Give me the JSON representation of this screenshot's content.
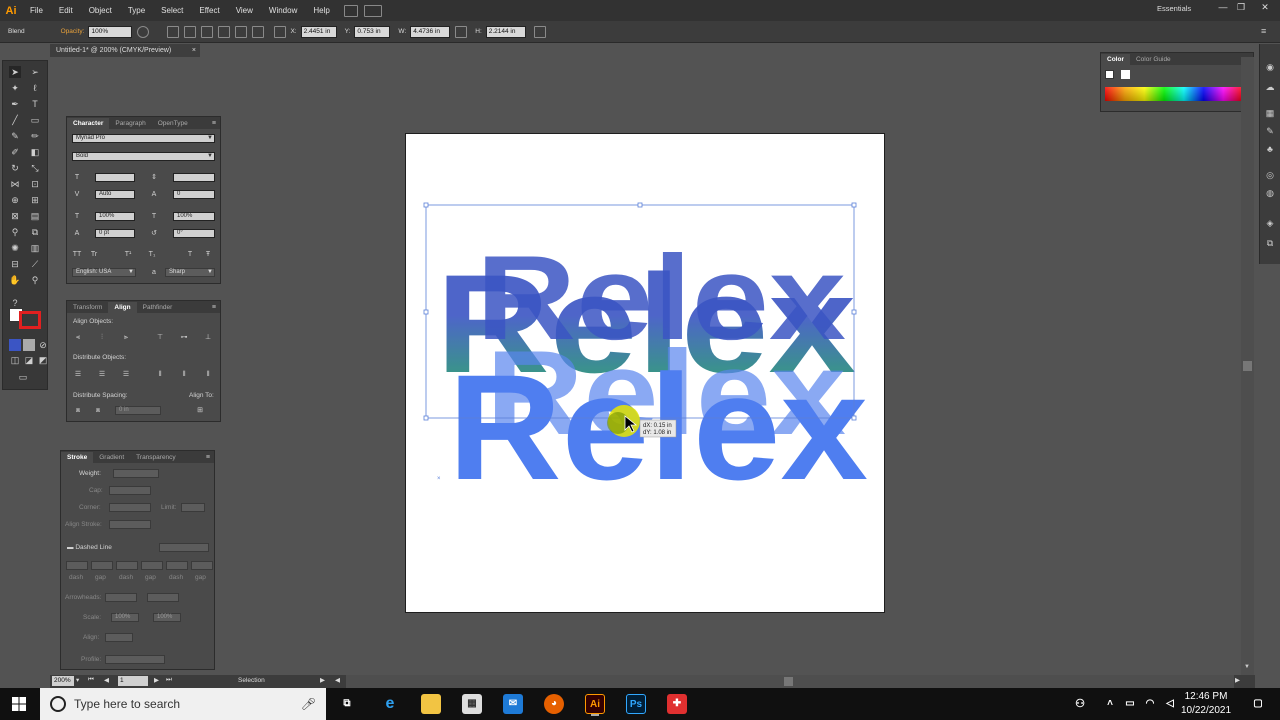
{
  "app": {
    "logo": "Ai"
  },
  "menubar": {
    "items": [
      "File",
      "Edit",
      "Object",
      "Type",
      "Select",
      "Effect",
      "View",
      "Window",
      "Help"
    ],
    "workspace": "Essentials",
    "window_buttons": [
      "—",
      "❐",
      "✕"
    ]
  },
  "controlbar": {
    "mode_label": "Blend",
    "opacity_label": "Opacity:",
    "opacity_value": "100%",
    "x_label": "X:",
    "x_value": "2.4451 in",
    "y_label": "Y:",
    "y_value": "0.753 in",
    "w_label": "W:",
    "w_value": "4.4736 in",
    "h_label": "H:",
    "h_value": "2.2144 in"
  },
  "document": {
    "tab_title": "Untitled-1* @ 200% (CMYK/Preview)",
    "close": "×"
  },
  "character_panel": {
    "tabs": [
      "Character",
      "Paragraph",
      "OpenType"
    ],
    "font_family": "Myriad Pro",
    "font_style": "Bold",
    "size_value": "",
    "leading_value": "",
    "kerning_value": "Auto",
    "tracking_value": "0",
    "vscale_value": "100%",
    "hscale_value": "100%",
    "baseline_value": "0 pt",
    "rotation_value": "0°",
    "language": "English: USA",
    "antialias": "Sharp",
    "tt_buttons": [
      "TT",
      "Tr",
      "T¹",
      "T₁",
      "T",
      "Ŧ"
    ]
  },
  "align_panel": {
    "tabs": [
      "Transform",
      "Align",
      "Pathfinder"
    ],
    "align_objects_label": "Align Objects:",
    "distribute_objects_label": "Distribute Objects:",
    "distribute_spacing_label": "Distribute Spacing:",
    "align_to_label": "Align To:",
    "spacing_value": "0 in"
  },
  "stroke_panel": {
    "tabs": [
      "Stroke",
      "Gradient",
      "Transparency"
    ],
    "weight_label": "Weight:",
    "cap_label": "Cap:",
    "corner_label": "Corner:",
    "limit_label": "Limit:",
    "align_stroke_label": "Align Stroke:",
    "dashed_line_label": "Dashed Line",
    "dash_labels": [
      "dash",
      "gap",
      "dash",
      "gap",
      "dash",
      "gap"
    ],
    "arrowheads_label": "Arrowheads:",
    "scale_label": "Scale:",
    "scale_values": [
      "100%",
      "100%"
    ],
    "align_label": "Align:",
    "profile_label": "Profile:"
  },
  "color_panel": {
    "tabs": [
      "Color",
      "Color Guide"
    ]
  },
  "canvas": {
    "text_top": "Relex",
    "text_mid": "Relex",
    "text_front": "Relex",
    "tooltip_dx": "dX: 0.15 in",
    "tooltip_dy": "dY: 1.08 in",
    "colors": {
      "gradient_start": "#1aa35a",
      "gradient_end": "#3b55c4",
      "blue": "#4f7ef0"
    }
  },
  "statusbar": {
    "zoom": "200%",
    "page": "1",
    "tool": "Selection"
  },
  "taskbar": {
    "search_placeholder": "Type here to search",
    "apps": [
      "task-view",
      "edge",
      "explorer",
      "store",
      "mail",
      "firefox",
      "Ai",
      "Ps",
      "utility"
    ],
    "time": "12:46 PM",
    "date": "10/22/2021"
  }
}
